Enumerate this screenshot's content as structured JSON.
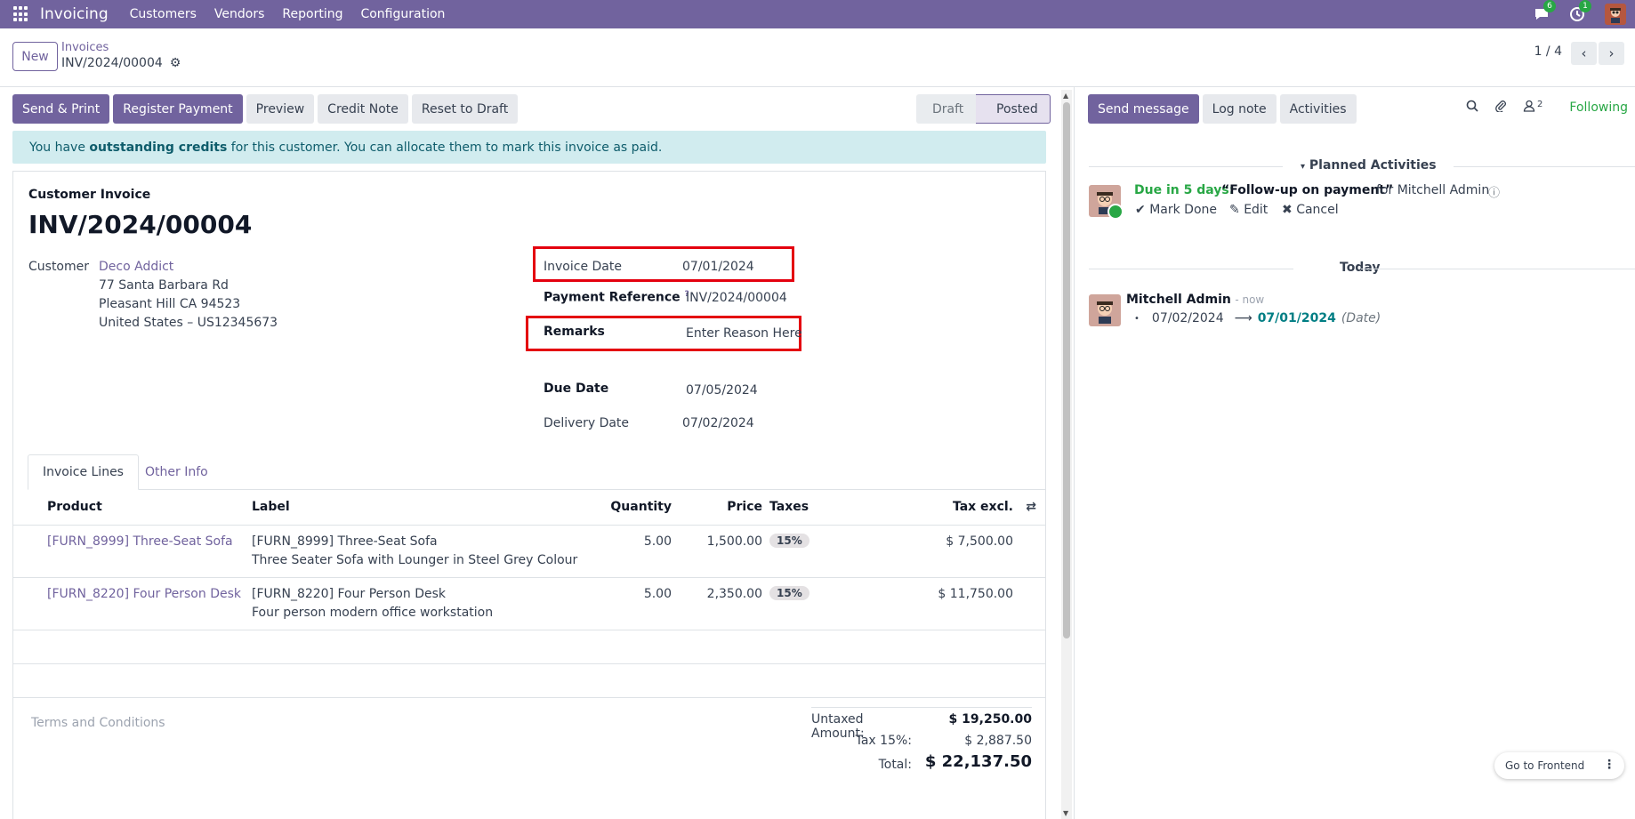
{
  "navbar": {
    "brand": "Invoicing",
    "menus": [
      "Customers",
      "Vendors",
      "Reporting",
      "Configuration"
    ],
    "messages_badge": "6",
    "activities_badge": "1"
  },
  "control_panel": {
    "new_label": "New",
    "breadcrumb_parent": "Invoices",
    "breadcrumb_current": "INV/2024/00004",
    "pager": "1 / 4"
  },
  "actions": {
    "send_print": "Send & Print",
    "register_payment": "Register Payment",
    "preview": "Preview",
    "credit_note": "Credit Note",
    "reset_to_draft": "Reset to Draft"
  },
  "status": {
    "draft": "Draft",
    "posted": "Posted"
  },
  "alert": {
    "prefix": "You have ",
    "bold": "outstanding credits",
    "suffix": " for this customer. You can allocate them to mark this invoice as paid."
  },
  "invoice": {
    "type": "Customer Invoice",
    "number": "INV/2024/00004",
    "customer_label": "Customer",
    "customer_name": "Deco Addict",
    "address_line1": "77 Santa Barbara Rd",
    "address_line2": "Pleasant Hill CA 94523",
    "address_line3": "United States – US12345673",
    "invoice_date_label": "Invoice Date",
    "invoice_date": "07/01/2024",
    "payment_ref_label": "Payment Reference",
    "payment_ref_help": "?",
    "payment_ref": "INV/2024/00004",
    "remarks_label": "Remarks",
    "remarks_placeholder": "Enter Reason Here",
    "due_date_label": "Due Date",
    "due_date": "07/05/2024",
    "delivery_date_label": "Delivery Date",
    "delivery_date": "07/02/2024"
  },
  "tabs": [
    "Invoice Lines",
    "Other Info"
  ],
  "lines": {
    "headers": {
      "product": "Product",
      "label": "Label",
      "quantity": "Quantity",
      "price": "Price",
      "taxes": "Taxes",
      "tax_excl": "Tax excl."
    },
    "rows": [
      {
        "product": "[FURN_8999] Three-Seat Sofa",
        "label1": "[FURN_8999] Three-Seat Sofa",
        "label2": "Three Seater Sofa with Lounger in Steel Grey Colour",
        "quantity": "5.00",
        "price": "1,500.00",
        "tax": "15%",
        "subtotal": "$ 7,500.00"
      },
      {
        "product": "[FURN_8220] Four Person Desk",
        "label1": "[FURN_8220] Four Person Desk",
        "label2": "Four person modern office workstation",
        "quantity": "5.00",
        "price": "2,350.00",
        "tax": "15%",
        "subtotal": "$ 11,750.00"
      }
    ]
  },
  "totals": {
    "terms_placeholder": "Terms and Conditions",
    "untaxed_label": "Untaxed Amount:",
    "untaxed": "$ 19,250.00",
    "tax_label": "Tax 15%:",
    "tax": "$ 2,887.50",
    "total_label": "Total:",
    "total": "$ 22,137.50"
  },
  "chatter": {
    "send_message": "Send message",
    "log_note": "Log note",
    "activities": "Activities",
    "followers_count": "2",
    "following": "Following",
    "planned_activities": "Planned Activities",
    "activity_due": "Due in 5 days:",
    "activity_title": "“Follow-up on payment”",
    "activity_for": "for Mitchell Admin",
    "mark_done": "Mark Done",
    "edit": "Edit",
    "cancel": "Cancel",
    "today": "Today",
    "msg_author": "Mitchell Admin",
    "msg_time": "- now",
    "msg_old_value": "07/02/2024",
    "msg_new_value": "07/01/2024",
    "msg_field": "(Date)"
  },
  "frontend_button": "Go to Frontend"
}
